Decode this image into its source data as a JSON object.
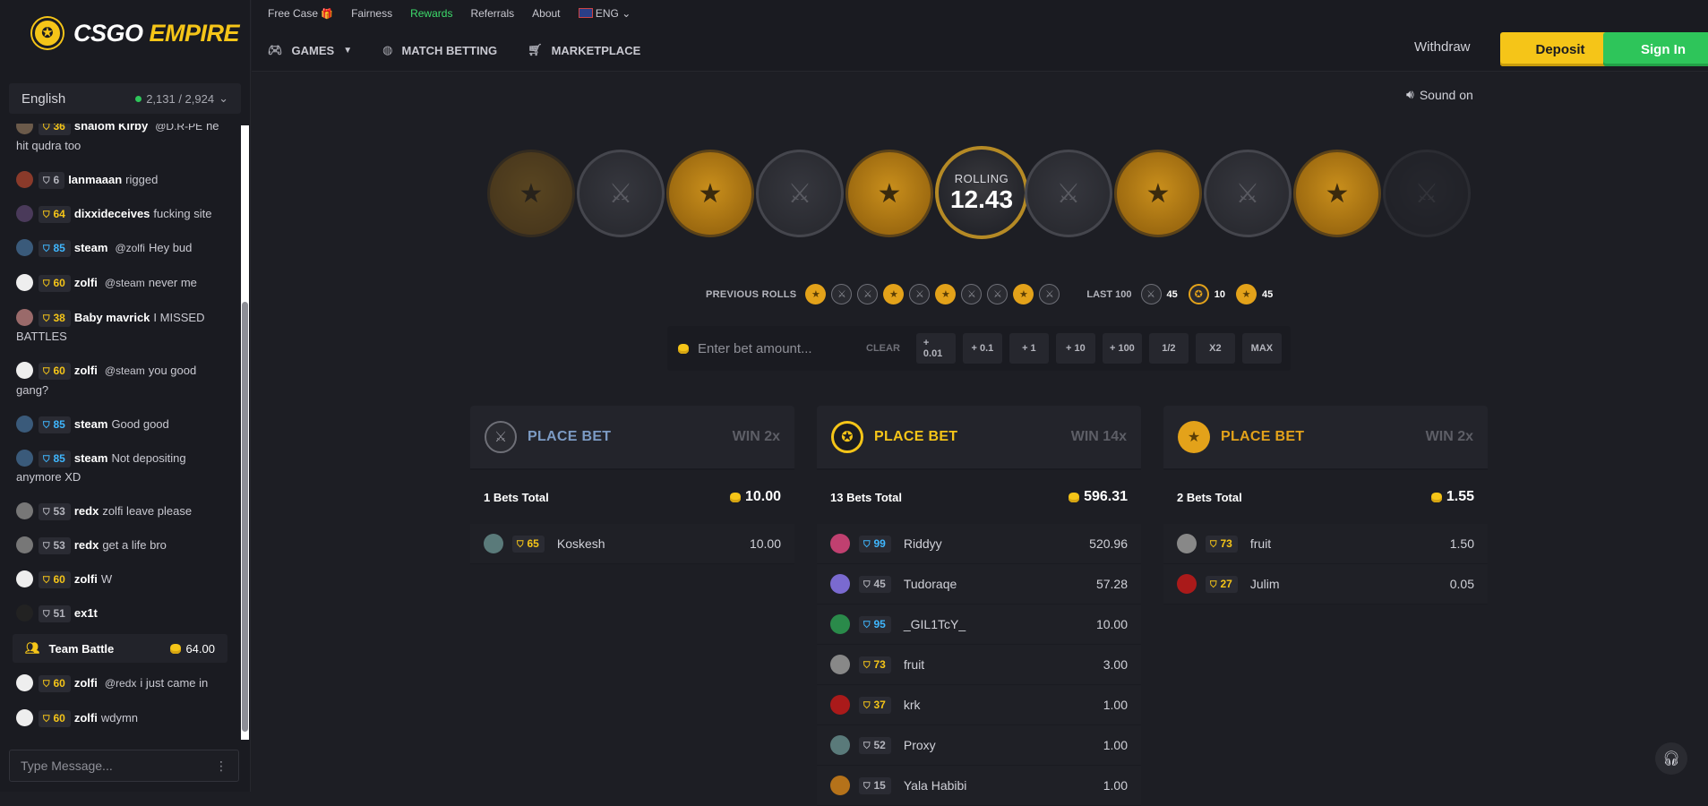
{
  "brand": {
    "part1": "CSGO",
    "part2": "EMPIRE"
  },
  "topbar": {
    "links": [
      {
        "label": "Free Case",
        "icon": "gift-icon"
      },
      {
        "label": "Fairness"
      },
      {
        "label": "Rewards"
      },
      {
        "label": "Referrals"
      },
      {
        "label": "About"
      },
      {
        "label": "ENG",
        "icon": "uk-flag-icon"
      }
    ],
    "nav": [
      {
        "label": "GAMES",
        "icon": "gamepad-icon"
      },
      {
        "label": "MATCH BETTING",
        "icon": "globe-icon"
      },
      {
        "label": "MARKETPLACE",
        "icon": "cart-icon"
      }
    ],
    "withdraw": "Withdraw",
    "deposit": "Deposit",
    "signin": "Sign In"
  },
  "chat": {
    "language": "English",
    "online": "2,131 / 2,924",
    "input_placeholder": "Type Message...",
    "messages": [
      {
        "level": "36",
        "tier": "gold",
        "user": "shalom Kirby",
        "mention": "@D.R-PE",
        "text": "he hit qudra too"
      },
      {
        "level": "6",
        "tier": "grey",
        "user": "Ianmaaan",
        "mention": "",
        "text": "rigged"
      },
      {
        "level": "64",
        "tier": "gold",
        "user": "dixxideceives",
        "mention": "",
        "text": "fucking site"
      },
      {
        "level": "85",
        "tier": "blue",
        "user": "steam",
        "mention": "@zolfi",
        "text": "Hey bud"
      },
      {
        "level": "60",
        "tier": "gold",
        "user": "zolfi",
        "mention": "@steam",
        "text": "never me"
      },
      {
        "level": "38",
        "tier": "gold",
        "user": "Baby mavrick",
        "mention": "",
        "text": "I MISSED BATTLES"
      },
      {
        "level": "60",
        "tier": "gold",
        "user": "zolfi",
        "mention": "@steam",
        "text": "you good gang?"
      },
      {
        "level": "85",
        "tier": "blue",
        "user": "steam",
        "mention": "",
        "text": "Good good"
      },
      {
        "level": "85",
        "tier": "blue",
        "user": "steam",
        "mention": "",
        "text": "Not depositing anymore XD"
      },
      {
        "level": "53",
        "tier": "grey",
        "user": "redx",
        "mention": "",
        "text": "zolfi leave please"
      },
      {
        "level": "53",
        "tier": "grey",
        "user": "redx",
        "mention": "",
        "text": "get a life bro"
      },
      {
        "level": "60",
        "tier": "gold",
        "user": "zolfi",
        "mention": "",
        "text": "W"
      },
      {
        "level": "51",
        "tier": "grey",
        "user": "ex1t",
        "mention": "",
        "text": ""
      }
    ],
    "team_battle": {
      "label": "Team Battle",
      "amount": "64.00"
    },
    "messages_after": [
      {
        "level": "60",
        "tier": "gold",
        "user": "zolfi",
        "mention": "@redx",
        "text": "i just came in"
      },
      {
        "level": "60",
        "tier": "gold",
        "user": "zolfi",
        "mention": "",
        "text": "wdymn"
      }
    ]
  },
  "sound": "Sound on",
  "roll": {
    "label": "ROLLING",
    "value": "12.43"
  },
  "previous_rolls": {
    "label": "PREVIOUS ROLLS",
    "rolls": [
      "t",
      "ct",
      "ct",
      "t",
      "ct",
      "t",
      "ct",
      "ct",
      "t",
      "ct"
    ],
    "last100_label": "LAST 100",
    "counts": {
      "ct": "45",
      "bonus": "10",
      "t": "45"
    }
  },
  "bet": {
    "placeholder": "Enter bet amount...",
    "clear": "CLEAR",
    "buttons": [
      "+ 0.01",
      "+ 0.1",
      "+ 1",
      "+ 10",
      "+ 100",
      "1/2",
      "X2",
      "MAX"
    ]
  },
  "columns": [
    {
      "side": "ct",
      "title": "PLACE BET",
      "win": "WIN 2x",
      "color": "#7c9bc4",
      "bets_total": "1 Bets Total",
      "amount": "10.00",
      "rows": [
        {
          "level": "65",
          "tier": "gold",
          "name": "Koskesh",
          "value": "10.00"
        }
      ]
    },
    {
      "side": "bonus",
      "title": "PLACE BET",
      "win": "WIN 14x",
      "color": "#f5c518",
      "bets_total": "13 Bets Total",
      "amount": "596.31",
      "rows": [
        {
          "level": "99",
          "tier": "blue",
          "name": "Riddyy",
          "value": "520.96"
        },
        {
          "level": "45",
          "tier": "grey",
          "name": "Tudoraqe",
          "value": "57.28"
        },
        {
          "level": "95",
          "tier": "blue",
          "name": "_GIL1TcY_",
          "value": "10.00"
        },
        {
          "level": "73",
          "tier": "gold",
          "name": "fruit",
          "value": "3.00"
        },
        {
          "level": "37",
          "tier": "gold",
          "name": "krk",
          "value": "1.00"
        },
        {
          "level": "52",
          "tier": "grey",
          "name": "Proxy",
          "value": "1.00"
        },
        {
          "level": "15",
          "tier": "grey",
          "name": "Yala Habibi",
          "value": "1.00"
        }
      ]
    },
    {
      "side": "t",
      "title": "PLACE BET",
      "win": "WIN 2x",
      "color": "#e3a21a",
      "bets_total": "2 Bets Total",
      "amount": "1.55",
      "rows": [
        {
          "level": "73",
          "tier": "gold",
          "name": "fruit",
          "value": "1.50"
        },
        {
          "level": "27",
          "tier": "gold",
          "name": "Julim",
          "value": "0.05"
        }
      ]
    }
  ]
}
